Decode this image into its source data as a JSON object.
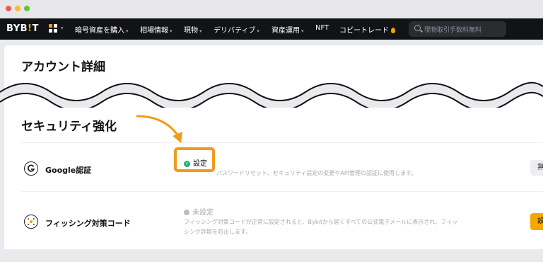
{
  "nav": {
    "logo_main": "BYB",
    "logo_bang": "!",
    "logo_end": "T",
    "items": [
      {
        "label": "暗号資産を購入",
        "caret": "▾"
      },
      {
        "label": "相場情報",
        "caret": "▾"
      },
      {
        "label": "現物",
        "caret": "▾"
      },
      {
        "label": "デリバティブ",
        "caret": "▾"
      },
      {
        "label": "資産運用",
        "caret": "▾"
      },
      {
        "label": "NFT",
        "caret": ""
      },
      {
        "label": "コピートレード",
        "caret": ""
      }
    ],
    "search_placeholder": "現物取引手数料無料",
    "grid_caret": "▾"
  },
  "account": {
    "title": "アカウント詳細"
  },
  "security": {
    "title": "セキュリティ強化",
    "rows": [
      {
        "label": "Google認証",
        "status": "設定",
        "description": "パスワードリセット、セキュリティ設定の変更やAPI管理の認証に使用します。",
        "button": "無"
      },
      {
        "label": "フィッシング対策コード",
        "status": "未設定",
        "description_line1": "フィッシング対策コードが正常に設定されると、Bybitから届くすべての公式電子メールに表示され、フィッ",
        "description_line2": "シング詐欺を防止します。",
        "button": "設"
      }
    ]
  },
  "colors": {
    "accent": "#f7a600",
    "highlight": "#f29a1d",
    "success": "#20b26c",
    "nav_bg": "#121316"
  }
}
